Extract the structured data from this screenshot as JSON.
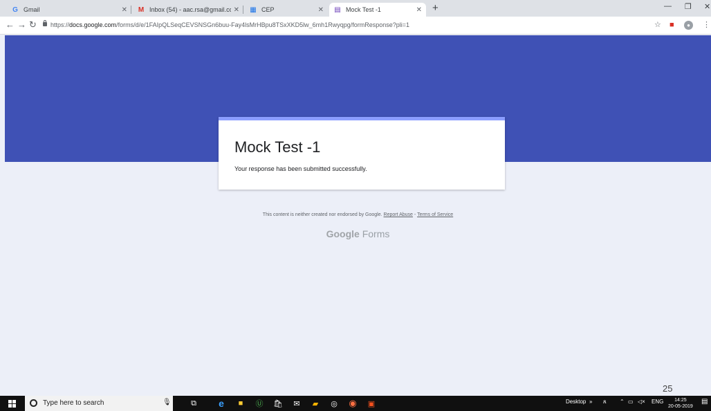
{
  "browser": {
    "tabs": [
      {
        "label": "Gmail",
        "favicon": "G",
        "favicon_color": "#4285f4"
      },
      {
        "label": "Inbox (54) - aac.rsa@gmail.com",
        "favicon": "M",
        "favicon_color": "#d93025"
      },
      {
        "label": "CEP",
        "favicon": "▦",
        "favicon_color": "#1a73e8"
      },
      {
        "label": "Mock Test -1",
        "favicon": "▤",
        "favicon_color": "#673ab7",
        "active": true
      }
    ],
    "new_tab": "+",
    "url_prefix": "https://",
    "url_host": "docs.google.com",
    "url_path": "/forms/d/e/1FAIpQLSeqCEVSNSGn6buu-Fay4lsMrHBpu8TSxXKD5lw_6mh1Rwyqpg/formResponse?pli=1"
  },
  "form": {
    "title": "Mock Test -1",
    "confirmation": "Your response has been submitted successfully.",
    "banner_color": "#3f51b5",
    "accent_color": "#8c9eff"
  },
  "footer": {
    "note": "This content is neither created nor endorsed by Google.",
    "report_abuse": "Report Abuse",
    "dash": " - ",
    "terms": "Terms of Service",
    "brand_google": "Google",
    "brand_forms": " Forms"
  },
  "page_number": "25",
  "taskbar": {
    "search_placeholder": "Type here to search",
    "desktop_label": "Desktop",
    "language": "ENG",
    "time": "14:25",
    "date": "20-05-2019"
  }
}
